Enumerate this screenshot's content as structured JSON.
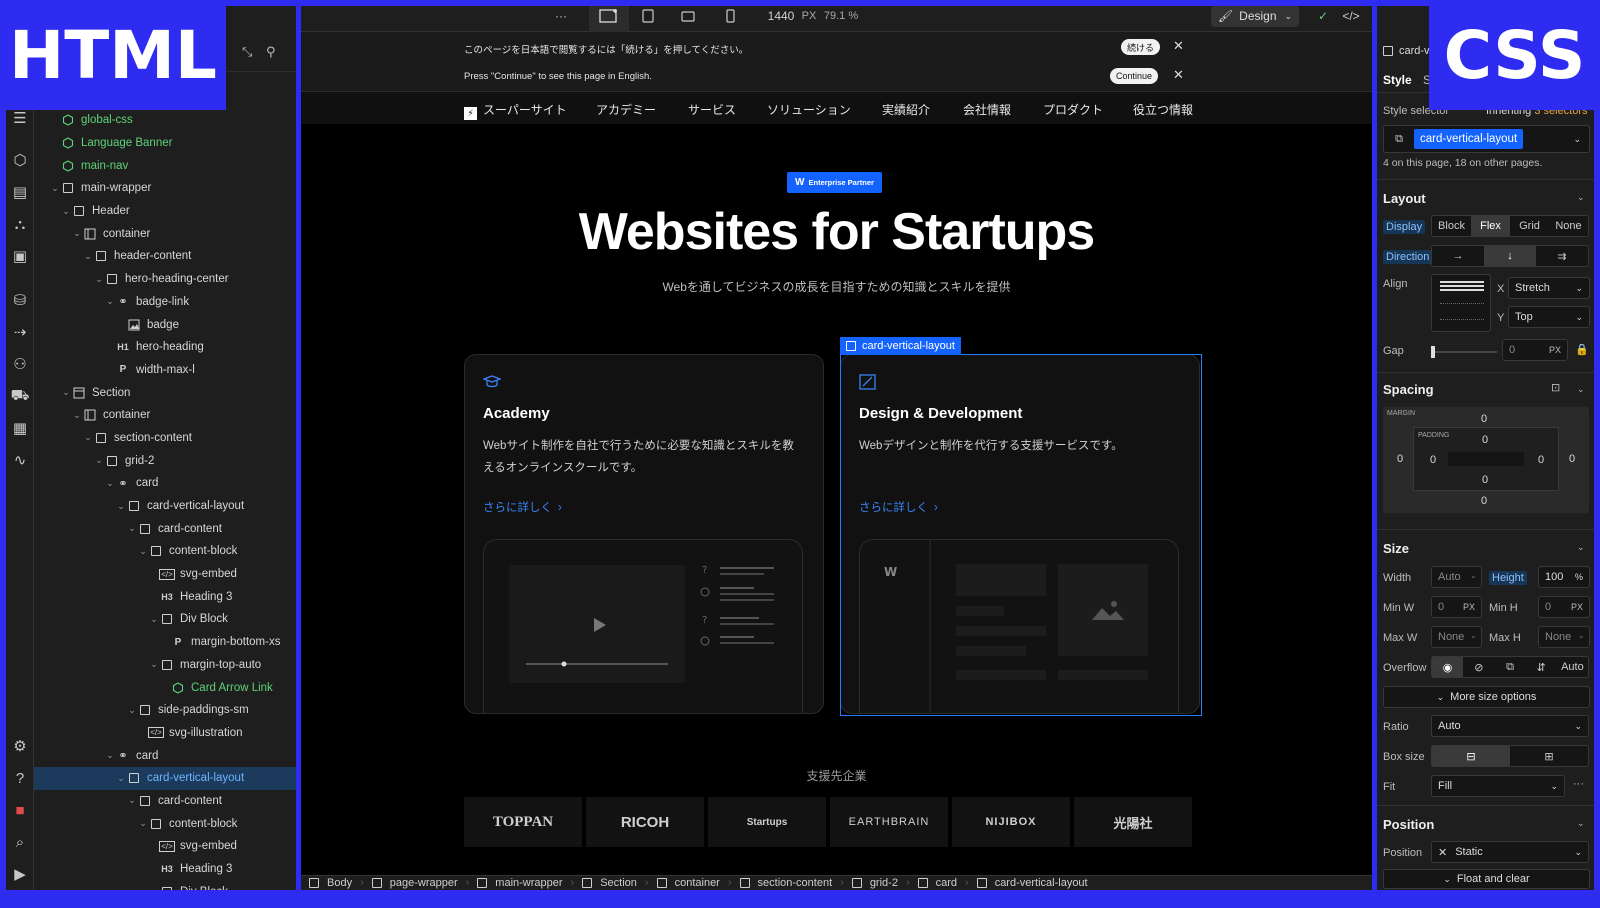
{
  "overlay_labels": {
    "left": "HTML",
    "right": "CSS"
  },
  "navigator": {
    "rows": [
      {
        "depth": 2,
        "label": "global-css",
        "kind": "comp"
      },
      {
        "depth": 2,
        "label": "Language Banner",
        "kind": "comp"
      },
      {
        "depth": 2,
        "label": "main-nav",
        "kind": "comp"
      },
      {
        "depth": 2,
        "label": "main-wrapper",
        "kind": "box",
        "arrow": "v"
      },
      {
        "depth": 3,
        "label": "Header",
        "kind": "box",
        "arrow": "v"
      },
      {
        "depth": 4,
        "label": "container",
        "kind": "col",
        "arrow": "v"
      },
      {
        "depth": 5,
        "label": "header-content",
        "kind": "box",
        "arrow": "v"
      },
      {
        "depth": 6,
        "label": "hero-heading-center",
        "kind": "box",
        "arrow": "v"
      },
      {
        "depth": 7,
        "label": "badge-link",
        "kind": "link",
        "arrow": "v"
      },
      {
        "depth": 8,
        "label": "badge",
        "kind": "img"
      },
      {
        "depth": 7,
        "label": "hero-heading",
        "kind": "h1"
      },
      {
        "depth": 7,
        "label": "width-max-l",
        "kind": "p"
      },
      {
        "depth": 3,
        "label": "Section",
        "kind": "sec",
        "arrow": "v"
      },
      {
        "depth": 4,
        "label": "container",
        "kind": "col",
        "arrow": "v"
      },
      {
        "depth": 5,
        "label": "section-content",
        "kind": "box",
        "arrow": "v"
      },
      {
        "depth": 6,
        "label": "grid-2",
        "kind": "box",
        "arrow": "v"
      },
      {
        "depth": 7,
        "label": "card",
        "kind": "link",
        "arrow": "v"
      },
      {
        "depth": 8,
        "label": "card-vertical-layout",
        "kind": "box",
        "arrow": "v"
      },
      {
        "depth": 9,
        "label": "card-content",
        "kind": "box",
        "arrow": "v"
      },
      {
        "depth": 10,
        "label": "content-block",
        "kind": "box",
        "arrow": "v"
      },
      {
        "depth": 11,
        "label": "svg-embed",
        "kind": "embed"
      },
      {
        "depth": 11,
        "label": "Heading 3",
        "kind": "h3"
      },
      {
        "depth": 11,
        "label": "Div Block",
        "kind": "box",
        "arrow": "v"
      },
      {
        "depth": 12,
        "label": "margin-bottom-xs",
        "kind": "p"
      },
      {
        "depth": 11,
        "label": "margin-top-auto",
        "kind": "box",
        "arrow": "v"
      },
      {
        "depth": 12,
        "label": "Card Arrow Link",
        "kind": "comp"
      },
      {
        "depth": 9,
        "label": "side-paddings-sm",
        "kind": "box",
        "arrow": "v"
      },
      {
        "depth": 10,
        "label": "svg-illustration",
        "kind": "embed"
      },
      {
        "depth": 7,
        "label": "card",
        "kind": "link",
        "arrow": "v"
      },
      {
        "depth": 8,
        "label": "card-vertical-layout",
        "kind": "box",
        "arrow": "v",
        "selected": true
      },
      {
        "depth": 9,
        "label": "card-content",
        "kind": "box",
        "arrow": "v"
      },
      {
        "depth": 10,
        "label": "content-block",
        "kind": "box",
        "arrow": "v"
      },
      {
        "depth": 11,
        "label": "svg-embed",
        "kind": "embed"
      },
      {
        "depth": 11,
        "label": "Heading 3",
        "kind": "h3"
      },
      {
        "depth": 11,
        "label": "Div Block",
        "kind": "box",
        "arrow": "v"
      }
    ]
  },
  "topbar": {
    "width_value": "1440",
    "width_unit": "PX",
    "zoom": "79.1 %",
    "design_label": "Design",
    "more": "···"
  },
  "banner": {
    "line_ja": "このページを日本語で閲覧するには「続ける」を押してください。",
    "btn_ja": "続ける",
    "line_en": "Press \"Continue\" to see this page in English.",
    "btn_en": "Continue"
  },
  "site_nav": {
    "brand": "スーパーサイト",
    "links": [
      "アカデミー",
      "サービス",
      "ソリューション",
      "実績紹介",
      "会社情報",
      "プロダクト",
      "役立つ情報"
    ]
  },
  "hero": {
    "badge": "Enterprise Partner",
    "title": "Websites for Startups",
    "subtitle": "Webを通してビジネスの成長を目指すための知識とスキルを提供"
  },
  "cards": [
    {
      "title": "Academy",
      "desc": "Webサイト制作を自社で行うために必要な知識とスキルを教えるオンラインスクールです。",
      "more": "さらに詳しく"
    },
    {
      "title": "Design & Development",
      "desc": "Webデザインと制作を代行する支援サービスです。",
      "more": "さらに詳しく"
    }
  ],
  "selection_tag": "card-vertical-layout",
  "partners": {
    "title": "支援先企業",
    "logos": [
      "TOPPAN",
      "RICOH",
      "Startups",
      "EARTHBRAIN",
      "NIJIBOX",
      "光陽社"
    ]
  },
  "breadcrumbs": [
    "Body",
    "page-wrapper",
    "main-wrapper",
    "Section",
    "container",
    "section-content",
    "grid-2",
    "card",
    "card-vertical-layout"
  ],
  "style_panel": {
    "element_name": "card-v",
    "tab_style": "Style",
    "tab_settings": "S",
    "selector_label": "Style selector",
    "inheriting": "Inheriting",
    "inheriting_count": "3 selectors",
    "selector_chip": "card-vertical-layout",
    "usage": "4 on this page, 18 on other pages.",
    "layout_title": "Layout",
    "display_label": "Display",
    "display_opts": [
      "Block",
      "Flex",
      "Grid",
      "None"
    ],
    "direction_label": "Direction",
    "align_label": "Align",
    "align_x_label": "X",
    "align_x": "Stretch",
    "align_y_label": "Y",
    "align_y": "Top",
    "gap_label": "Gap",
    "gap_value": "0",
    "gap_unit": "PX",
    "spacing_title": "Spacing",
    "margin_label": "MARGIN",
    "padding_label": "PADDING",
    "zero": "0",
    "size_title": "Size",
    "width_label": "Width",
    "width_val": "Auto",
    "height_label": "Height",
    "height_val": "100",
    "height_unit": "%",
    "minw_label": "Min W",
    "minw_val": "0",
    "minh_label": "Min H",
    "minh_val": "0",
    "px": "PX",
    "maxw_label": "Max W",
    "maxw_val": "None",
    "maxh_label": "Max H",
    "maxh_val": "None",
    "overflow_label": "Overflow",
    "overflow_auto": "Auto",
    "more_size": "More size options",
    "ratio_label": "Ratio",
    "ratio_val": "Auto",
    "boxsize_label": "Box size",
    "fit_label": "Fit",
    "fit_val": "Fill",
    "position_title": "Position",
    "position_label": "Position",
    "position_val": "Static",
    "float_clear": "Float and clear",
    "dash": "-"
  },
  "colors": {
    "accent": "#1463ff",
    "link": "#3b82f6",
    "component": "#5dd27a",
    "frame": "#2f2cf2"
  }
}
